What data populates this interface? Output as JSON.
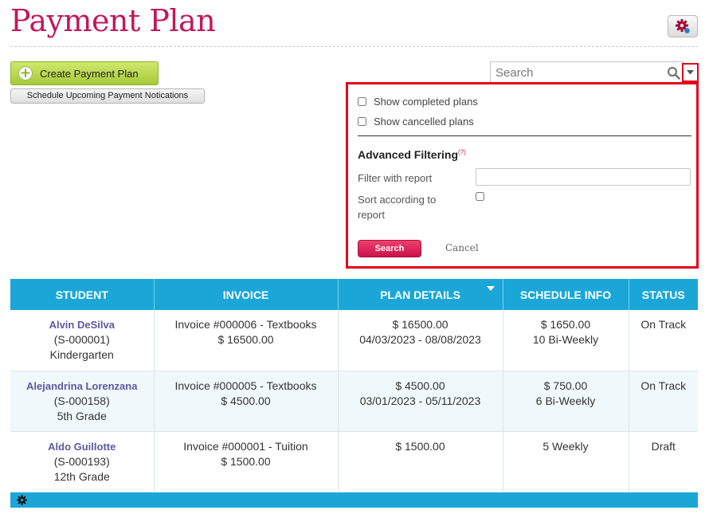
{
  "page": {
    "title": "Payment Plan"
  },
  "toolbar": {
    "create_label": "Create Payment Plan",
    "schedule_label": "Schedule Upcoming Payment Notications"
  },
  "search": {
    "placeholder": "Search"
  },
  "filter_panel": {
    "show_completed": "Show completed plans",
    "show_cancelled": "Show cancelled plans",
    "advanced_title": "Advanced Filtering",
    "help_mark": "(?)",
    "filter_with_report": "Filter with report",
    "sort_line1": "Sort according to",
    "sort_line2": "report",
    "search_button": "Search",
    "cancel_link": "Cancel"
  },
  "table": {
    "headers": [
      "STUDENT",
      "INVOICE",
      "PLAN DETAILS",
      "SCHEDULE INFO",
      "STATUS"
    ],
    "rows": [
      {
        "name": "Alvin DeSilva",
        "id": "(S-000001)",
        "grade": "Kindergarten",
        "invoice_line1": "Invoice #000006 - Textbooks",
        "invoice_line2": "$ 16500.00",
        "plan_line1": "$ 16500.00",
        "plan_line2": "04/03/2023 - 08/08/2023",
        "schedule_line1": "$ 1650.00",
        "schedule_line2": "10 Bi-Weekly",
        "status": "On Track"
      },
      {
        "name": "Alejandrina Lorenzana",
        "id": "(S-000158)",
        "grade": "5th Grade",
        "invoice_line1": "Invoice #000005 - Textbooks",
        "invoice_line2": "$ 4500.00",
        "plan_line1": "$ 4500.00",
        "plan_line2": "03/01/2023 - 05/11/2023",
        "schedule_line1": "$ 750.00",
        "schedule_line2": "6 Bi-Weekly",
        "status": "On Track"
      },
      {
        "name": "Aldo Guillotte",
        "id": "(S-000193)",
        "grade": "12th Grade",
        "invoice_line1": "Invoice #000001 - Tuition",
        "invoice_line2": "$ 1500.00",
        "plan_line1": "$ 1500.00",
        "plan_line2": "",
        "schedule_line1": "5 Weekly",
        "schedule_line2": "",
        "status": "Draft"
      }
    ]
  },
  "colors": {
    "brand_title": "#c2185b",
    "table_header": "#1aa7d8",
    "highlight_border": "#e3001b",
    "create_button": "#b5d34a"
  },
  "icons": {
    "settings": "gear-icon",
    "search": "search-icon",
    "dropdown": "caret-down-icon",
    "footer": "gear-icon"
  }
}
